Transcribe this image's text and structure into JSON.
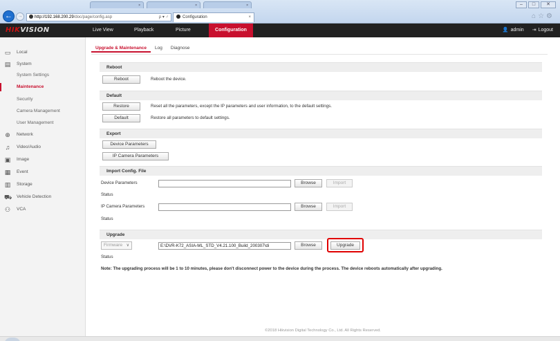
{
  "browser": {
    "url_host": "http://192.168.200.29",
    "url_path": "/doc/page/config.asp",
    "url_controls": "ρ ▾ ♂",
    "active_tab_title": "Configuration",
    "tab_close": "×"
  },
  "app": {
    "logo_a": "HIK",
    "logo_b": "VISION",
    "nav": [
      "Live View",
      "Playback",
      "Picture",
      "Configuration"
    ],
    "user": "admin",
    "logout": "Logout"
  },
  "sidebar": {
    "local": "Local",
    "system": "System",
    "system_settings": "System Settings",
    "maintenance": "Maintenance",
    "security": "Security",
    "camera_management": "Camera Management",
    "user_management": "User Management",
    "network": "Network",
    "video_audio": "Video/Audio",
    "image": "Image",
    "event": "Event",
    "storage": "Storage",
    "vehicle_detection": "Vehicle Detection",
    "vca": "VCA"
  },
  "subtabs": [
    "Upgrade & Maintenance",
    "Log",
    "Diagnose"
  ],
  "reboot": {
    "title": "Reboot",
    "button": "Reboot",
    "desc": "Reboot the device."
  },
  "default": {
    "title": "Default",
    "restore_button": "Restore",
    "restore_desc": "Reset all the parameters, except the IP parameters and user information, to the default settings.",
    "default_button": "Default",
    "default_desc": "Restore all parameters to default settings."
  },
  "export": {
    "title": "Export",
    "device_params_button": "Device Parameters",
    "ip_camera_params_button": "IP Camera Parameters"
  },
  "import": {
    "title": "Import Config. File",
    "device_params_label": "Device Parameters",
    "status1": "Status",
    "ip_camera_params_label": "IP Camera Parameters",
    "status2": "Status",
    "browse": "Browse",
    "import_button": "Import"
  },
  "upgrade": {
    "title": "Upgrade",
    "type_select": "Firmware",
    "file_path": "E:\\DVR-K72_ASIA-ML_STD_V4.21.100_Build_200307\\di",
    "browse": "Browse",
    "upgrade_button": "Upgrade",
    "status": "Status",
    "note": "Note: The upgrading process will be 1 to 10 minutes, please don't disconnect power to the device during the process. The device reboots automatically after upgrading."
  },
  "footer": "©2018 Hikvision Digital Technology Co., Ltd. All Rights Reserved.",
  "colors": {
    "accent": "#c8102e",
    "highlight_ring": "#e00000",
    "header_bg": "#212121"
  }
}
